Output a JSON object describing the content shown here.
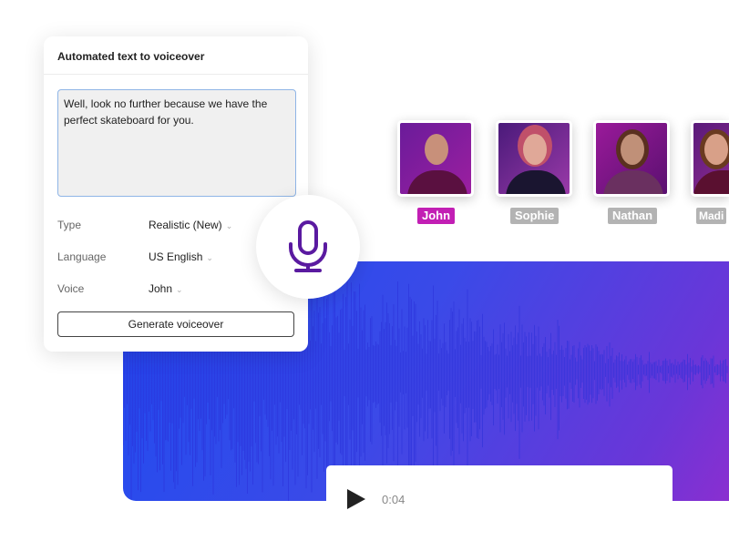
{
  "panel": {
    "title": "Automated text to voiceover",
    "script_text": "Well, look no further because we have the perfect skateboard for you.",
    "fields": [
      {
        "label": "Type",
        "value": "Realistic (New)"
      },
      {
        "label": "Language",
        "value": "US English"
      },
      {
        "label": "Voice",
        "value": "John"
      }
    ],
    "generate_label": "Generate voiceover"
  },
  "mic": {
    "icon": "microphone-icon",
    "color": "#5a1aa0"
  },
  "voices": [
    {
      "name": "John",
      "selected": true
    },
    {
      "name": "Sophie",
      "selected": false
    },
    {
      "name": "Nathan",
      "selected": false
    },
    {
      "name": "Madi",
      "selected": false
    }
  ],
  "player": {
    "icon": "play-icon",
    "time": "0:04"
  },
  "colors": {
    "accent": "#c21fb4",
    "wave_start": "#1f4cf0",
    "wave_end": "#8a2fd0"
  }
}
